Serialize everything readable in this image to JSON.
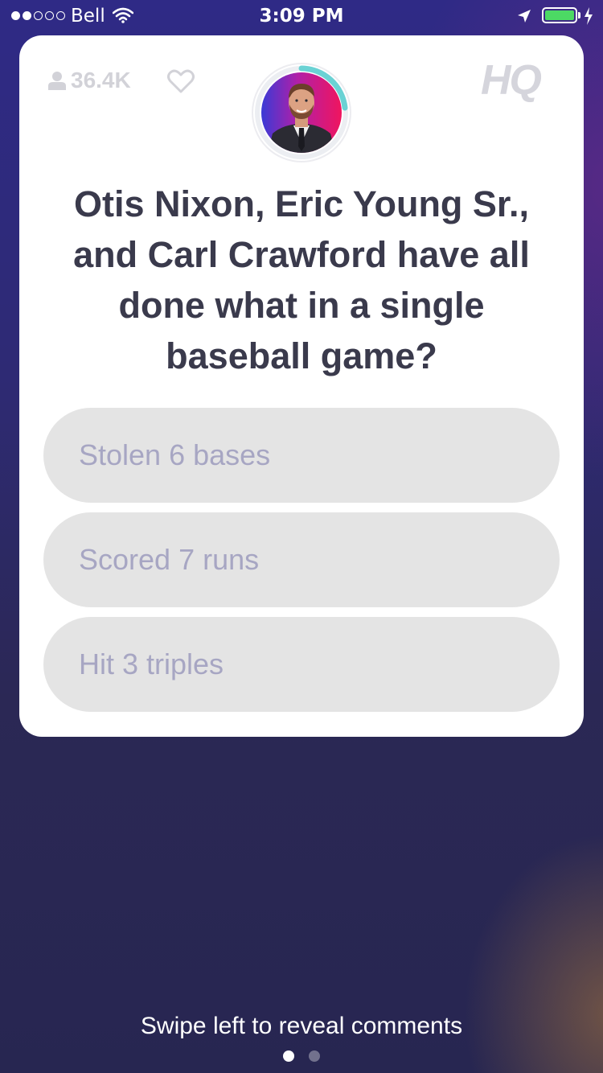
{
  "status_bar": {
    "carrier": "Bell",
    "time": "3:09 PM",
    "signal_bars_filled": 2,
    "signal_bars_total": 5,
    "battery_color": "#4cd964"
  },
  "card": {
    "viewer_count": "36.4K",
    "logo_text": "HQ",
    "question": "Otis Nixon, Eric Young Sr., and Carl Crawford have all done what in a single baseball game?",
    "answers": [
      {
        "label": "Stolen 6 bases"
      },
      {
        "label": "Scored 7 runs"
      },
      {
        "label": "Hit 3 triples"
      }
    ],
    "timer_color": "#6ad2d4"
  },
  "footer": {
    "swipe_hint": "Swipe left to reveal comments",
    "page_count": 2,
    "active_page": 1
  },
  "icons": [
    "signal-icon",
    "wifi-icon",
    "location-arrow-icon",
    "battery-icon",
    "charging-icon",
    "user-icon",
    "heart-icon",
    "host-avatar"
  ]
}
